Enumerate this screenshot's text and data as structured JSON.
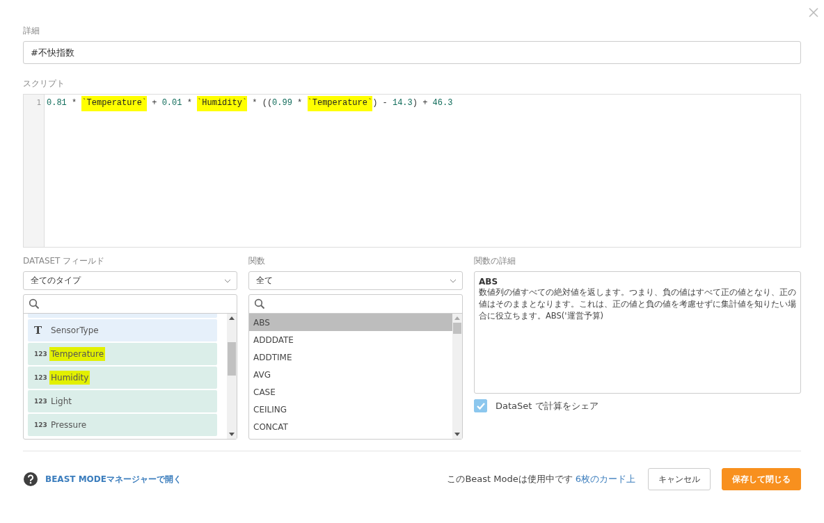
{
  "details": {
    "label": "詳細",
    "value": "#不快指数"
  },
  "script": {
    "label": "スクリプト",
    "line_number": "1",
    "tokens": [
      {
        "kind": "number",
        "text": "0.81"
      },
      {
        "kind": "op",
        "text": " * "
      },
      {
        "kind": "field",
        "text": "`Temperature`"
      },
      {
        "kind": "op",
        "text": " + "
      },
      {
        "kind": "number",
        "text": "0.01"
      },
      {
        "kind": "op",
        "text": " * "
      },
      {
        "kind": "field",
        "text": "`Humidity`"
      },
      {
        "kind": "op",
        "text": " * (("
      },
      {
        "kind": "number",
        "text": "0.99"
      },
      {
        "kind": "op",
        "text": " * "
      },
      {
        "kind": "field",
        "text": "`Temperature`"
      },
      {
        "kind": "op",
        "text": ") - "
      },
      {
        "kind": "number",
        "text": "14.3"
      },
      {
        "kind": "op",
        "text": ") + "
      },
      {
        "kind": "number",
        "text": "46.3"
      }
    ]
  },
  "dataset_fields": {
    "label": "DATASET フィールド",
    "filter": "全てのタイプ",
    "items": [
      {
        "kind": "text",
        "type_icon": "T",
        "name": "SensorType",
        "highlighted": false
      },
      {
        "kind": "number",
        "type_icon": "123",
        "name": "Temperature",
        "highlighted": true
      },
      {
        "kind": "number",
        "type_icon": "123",
        "name": "Humidity",
        "highlighted": true
      },
      {
        "kind": "number",
        "type_icon": "123",
        "name": "Light",
        "highlighted": false
      },
      {
        "kind": "number",
        "type_icon": "123",
        "name": "Pressure",
        "highlighted": false
      }
    ]
  },
  "functions": {
    "label": "関数",
    "filter": "全て",
    "items": [
      {
        "name": "ABS",
        "selected": true
      },
      {
        "name": "ADDDATE",
        "selected": false
      },
      {
        "name": "ADDTIME",
        "selected": false
      },
      {
        "name": "AVG",
        "selected": false
      },
      {
        "name": "CASE",
        "selected": false
      },
      {
        "name": "CEILING",
        "selected": false
      },
      {
        "name": "CONCAT",
        "selected": false
      }
    ]
  },
  "function_details": {
    "label": "関数の詳細",
    "name": "ABS",
    "description": "数値列の値すべての絶対値を返します。つまり、負の値はすべて正の値となり、正の値はそのままとなります。これは、正の値と負の値を考慮せずに集計値を知りたい場合に役立ちます。ABS('運営予算)"
  },
  "share": {
    "label": "DataSet で計算をシェア",
    "checked": true
  },
  "footer": {
    "manager_link": "BEAST MODEマネージャーで開く",
    "usage_text": "このBeast Modeは使用中です",
    "usage_link": "6枚のカード上",
    "cancel": "キャンセル",
    "save": "保存して閉じる"
  }
}
